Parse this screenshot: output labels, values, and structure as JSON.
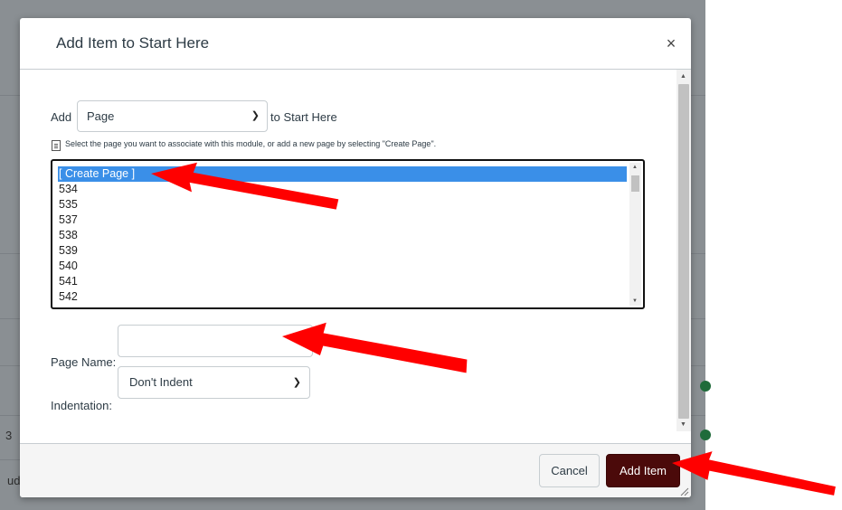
{
  "background": {
    "fragments": [
      "3",
      "ud"
    ]
  },
  "dialog": {
    "title": "Add Item to Start Here",
    "close_symbol": "×",
    "add_label": "Add",
    "type_select_value": "Page",
    "to_label": "to Start Here",
    "hint": "Select the page you want to associate with this module, or add a new page by selecting \"Create Page\".",
    "page_list": {
      "items": [
        "[ Create Page ]",
        "534",
        "535",
        "537",
        "538",
        "539",
        "540",
        "541",
        "542"
      ],
      "selected_index": 0
    },
    "page_name_label": "Page Name:",
    "page_name_value": "",
    "indentation_label": "Indentation:",
    "indentation_value": "Don't Indent",
    "cancel_label": "Cancel",
    "add_item_label": "Add Item"
  },
  "colors": {
    "accent": "#4b0a0a",
    "selection": "#3a8fe8",
    "annotation_arrow": "#ff0000",
    "overlay": "#8a8f93"
  },
  "icons": [
    "close-icon",
    "document-icon",
    "chevron-down-icon",
    "resize-grip-icon",
    "arrow-annotation"
  ]
}
